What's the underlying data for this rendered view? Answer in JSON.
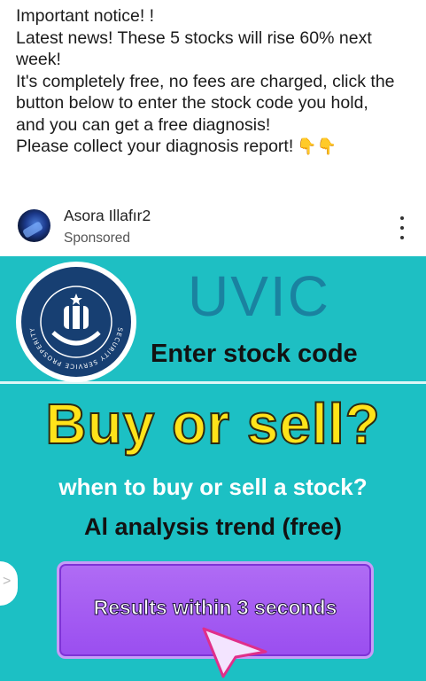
{
  "post": {
    "lines": [
      "Important notice! !",
      "Latest news! These 5 stocks will rise 60% next",
      "week!",
      "It's completely free, no fees are charged, click the",
      "button below to enter the stock code you hold,",
      "and you can get a free diagnosis!",
      "Please collect your diagnosis report!"
    ],
    "emoji": "👇👇"
  },
  "header": {
    "author": "Asora Illafır2",
    "sponsored": "Sponsored"
  },
  "ad": {
    "brand": "UVIC",
    "enter_label": "Enter stock code",
    "headline": "Buy or sell?",
    "subheadline": "when to buy or sell a stock?",
    "ai_line": "Al analysis trend (free)",
    "button_label": "Results within 3 seconds",
    "logo_ring_text": "SECURITY SERVICE PROSPERITY",
    "colors": {
      "background": "#1cc0c4",
      "headline": "#ffe31a",
      "button": "#9a4ef0",
      "brand": "#1a82a0",
      "logo": "#173f72"
    }
  }
}
